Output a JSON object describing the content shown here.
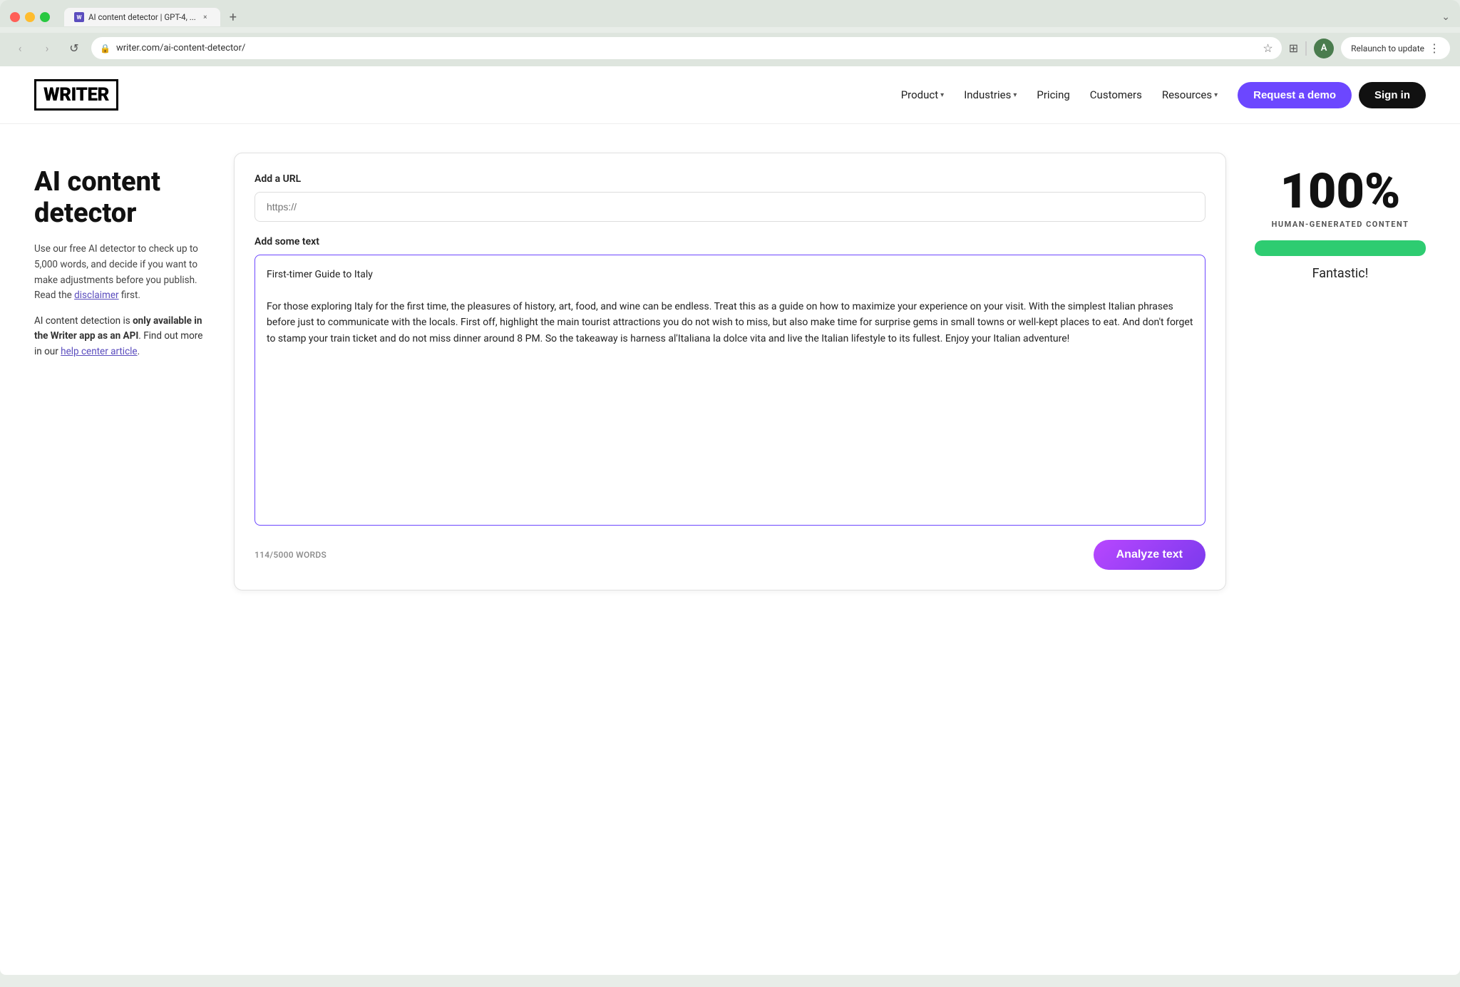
{
  "browser": {
    "tab_title": "AI content detector | GPT-4, ...",
    "tab_close": "×",
    "tab_new": "+",
    "tab_dropdown": "⌄",
    "favicon_letter": "W",
    "address": "writer.com/ai-content-detector/",
    "back_btn": "‹",
    "forward_btn": "›",
    "refresh_btn": "↺",
    "star_icon": "☆",
    "extensions_icon": "⊞",
    "avatar_letter": "A",
    "relaunch_label": "Relaunch to update",
    "relaunch_dots": "⋮"
  },
  "nav": {
    "logo": "WRITER",
    "links": [
      {
        "label": "Product",
        "has_caret": true
      },
      {
        "label": "Industries",
        "has_caret": true
      },
      {
        "label": "Pricing",
        "has_caret": false
      },
      {
        "label": "Customers",
        "has_caret": false
      },
      {
        "label": "Resources",
        "has_caret": true
      }
    ],
    "demo_btn": "Request a demo",
    "signin_btn": "Sign in"
  },
  "sidebar": {
    "heading_line1": "AI content",
    "heading_line2": "detector",
    "description1": "Use our free AI detector to check up to 5,000 words, and decide if you want to make adjustments before you publish. Read the ",
    "disclaimer_link": "disclaimer",
    "description1_end": " first.",
    "description2_before": "AI content detection is ",
    "description2_bold": "only available in the Writer app as an API",
    "description2_after": ". Find out more in our ",
    "help_link": "help center article",
    "description2_end": "."
  },
  "card": {
    "url_label": "Add a URL",
    "url_placeholder": "https://",
    "text_label": "Add some text",
    "text_content": "First-timer Guide to Italy\n\nFor those exploring Italy for the first time, the pleasures of history, art, food, and wine can be endless. Treat this as a guide on how to maximize your experience on your visit. With the simplest Italian phrases before just to communicate with the locals. First off, highlight the main tourist attractions you do not wish to miss, but also make time for surprise gems in small towns or well-kept places to eat. And don't forget to stamp your train ticket and do not miss dinner around 8 PM. So the takeaway is harness al'Italiana la dolce vita and live the Italian lifestyle to its fullest. Enjoy your Italian adventure!",
    "word_count": "114/5000 WORDS",
    "analyze_btn": "Analyze text"
  },
  "result": {
    "percentage": "100%",
    "label": "HUMAN-GENERATED CONTENT",
    "progress": 100,
    "verdict": "Fantastic!"
  }
}
